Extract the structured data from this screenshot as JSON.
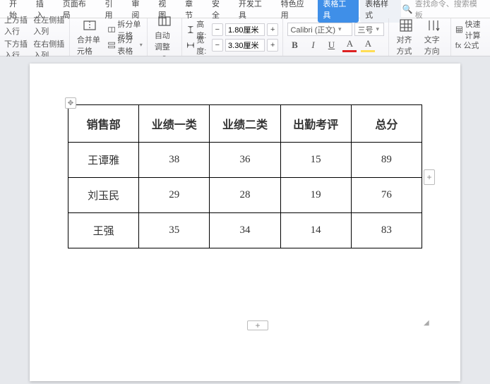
{
  "menu": {
    "items": [
      "开始",
      "插入",
      "页面布局",
      "引用",
      "审阅",
      "视图",
      "章节",
      "安全",
      "开发工具",
      "特色应用",
      "表格工具",
      "表格样式"
    ],
    "active_index": 10,
    "search_label": "查找命令、搜索模板"
  },
  "ribbon": {
    "insert_rows": {
      "top": "上方插入行",
      "bottom": "下方插入行",
      "left": "在左侧插入列",
      "right": "在右侧插入列"
    },
    "merge": {
      "merge": "合并单元格",
      "split_cell": "拆分单元格",
      "split_table": "拆分表格"
    },
    "autofit": "自动调整",
    "height_label": "高度:",
    "height_val": "1.80厘米",
    "width_label": "宽度:",
    "width_val": "3.30厘米",
    "font_name": "Calibri (正文)",
    "font_size": "三号",
    "align": "对齐方式",
    "text_dir": "文字方向",
    "quick_calc": "快速计算",
    "formula": "fx 公式"
  },
  "chart_data": {
    "type": "table",
    "headers": [
      "销售部",
      "业绩一类",
      "业绩二类",
      "出勤考评",
      "总分"
    ],
    "rows": [
      [
        "王谭雅",
        "38",
        "36",
        "15",
        "89"
      ],
      [
        "刘玉民",
        "29",
        "28",
        "19",
        "76"
      ],
      [
        "王强",
        "35",
        "34",
        "14",
        "83"
      ]
    ]
  }
}
